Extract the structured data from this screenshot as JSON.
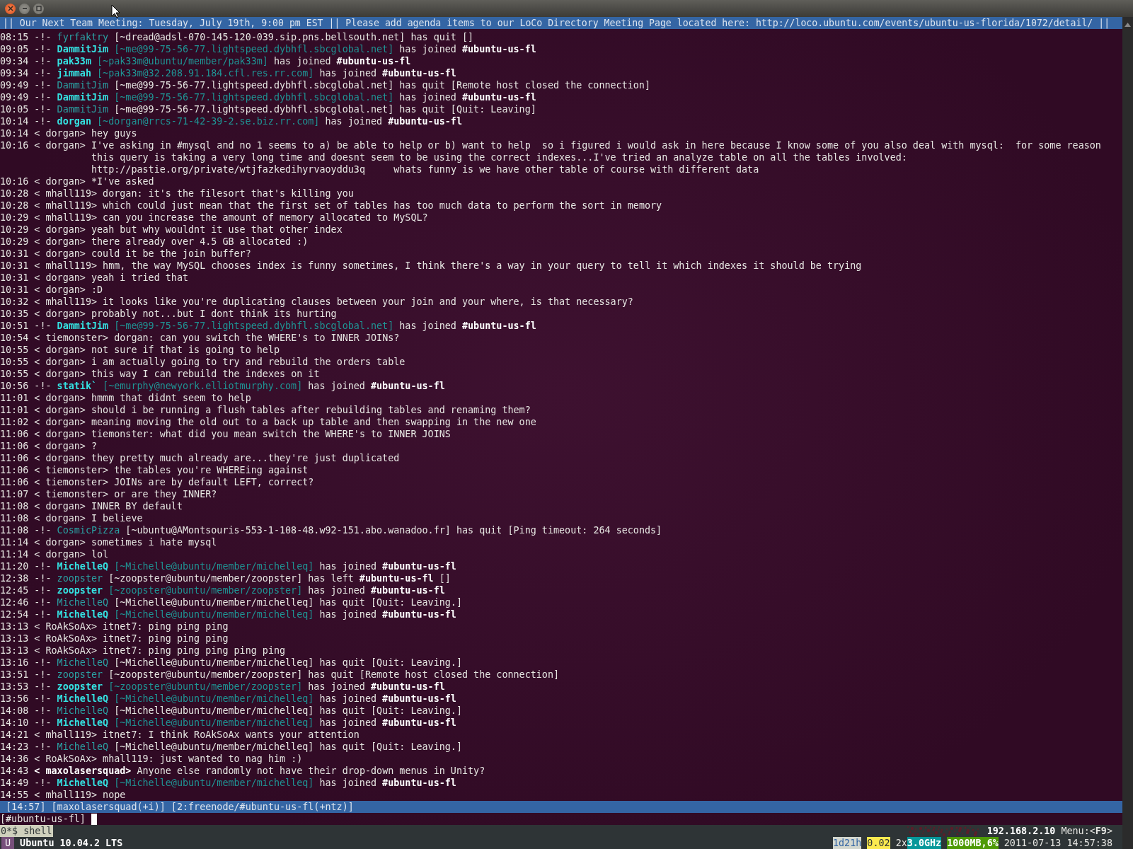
{
  "window": {
    "buttons": [
      {
        "kind": "close"
      },
      {
        "kind": "minimize"
      },
      {
        "kind": "maximize"
      }
    ]
  },
  "topic": "|| Our Next Team Meeting: Tuesday, July 19th, 9:00 pm EST || Please add agenda items to our LoCo Directory Meeting Page located here: http://loco.ubuntu.com/events/ubuntu-us-florida/1072/detail/ ||",
  "log": [
    {
      "kind": "quit",
      "time": "08:15",
      "marker": "-!-",
      "nick": "fyrfaktry",
      "host": "[~dread@adsl-070-145-120-039.sip.pns.bellsouth.net]",
      "action": "has quit",
      "reason": "[]"
    },
    {
      "kind": "join",
      "time": "09:05",
      "marker": "-!-",
      "nick": "DammitJim",
      "host": "[~me@99-75-56-77.lightspeed.dybhfl.sbcglobal.net]",
      "action": "has joined",
      "channel": "#ubuntu-us-fl"
    },
    {
      "kind": "join",
      "time": "09:34",
      "marker": "-!-",
      "nick": "pak33m",
      "host": "[~pak33m@ubuntu/member/pak33m]",
      "action": "has joined",
      "channel": "#ubuntu-us-fl"
    },
    {
      "kind": "join",
      "time": "09:34",
      "marker": "-!-",
      "nick": "jimmah",
      "host": "[~pak33m@32.208.91.184.cfl.res.rr.com]",
      "action": "has joined",
      "channel": "#ubuntu-us-fl"
    },
    {
      "kind": "quit",
      "time": "09:49",
      "marker": "-!-",
      "nick": "DammitJim",
      "host": "[~me@99-75-56-77.lightspeed.dybhfl.sbcglobal.net]",
      "action": "has quit",
      "reason": "[Remote host closed the connection]"
    },
    {
      "kind": "join",
      "time": "09:49",
      "marker": "-!-",
      "nick": "DammitJim",
      "host": "[~me@99-75-56-77.lightspeed.dybhfl.sbcglobal.net]",
      "action": "has joined",
      "channel": "#ubuntu-us-fl"
    },
    {
      "kind": "quit",
      "time": "10:05",
      "marker": "-!-",
      "nick": "DammitJim",
      "host": "[~me@99-75-56-77.lightspeed.dybhfl.sbcglobal.net]",
      "action": "has quit",
      "reason": "[Quit: Leaving]"
    },
    {
      "kind": "join",
      "time": "10:14",
      "marker": "-!-",
      "nick": "dorgan",
      "host": "[~dorgan@rrcs-71-42-39-2.se.biz.rr.com]",
      "action": "has joined",
      "channel": "#ubuntu-us-fl"
    },
    {
      "kind": "message",
      "time": "10:14",
      "nick": "< dorgan>",
      "text": "hey guys",
      "own": false
    },
    {
      "kind": "message",
      "time": "10:16",
      "nick": "< dorgan>",
      "text": "I've asking in #mysql and no 1 seems to a) be able to help or b) want to help  so i figured i would ask in here because I know some of you also deal with mysql:  for some reason",
      "more": [
        "this query is taking a very long time and doesnt seem to be using the correct indexes...I've tried an analyze table on all the tables involved:",
        "http://pastie.org/private/wtjfazkedihyrvaoyddu3q     whats funny is we have other table of course with different data"
      ],
      "own": false
    },
    {
      "kind": "message",
      "time": "10:16",
      "nick": "< dorgan>",
      "text": "*I've asked",
      "own": false
    },
    {
      "kind": "message",
      "time": "10:28",
      "nick": "< mhall119>",
      "text": "dorgan: it's the filesort that's killing you",
      "own": false
    },
    {
      "kind": "message",
      "time": "10:28",
      "nick": "< mhall119>",
      "text": "which could just mean that the first set of tables has too much data to perform the sort in memory",
      "own": false
    },
    {
      "kind": "message",
      "time": "10:29",
      "nick": "< mhall119>",
      "text": "can you increase the amount of memory allocated to MySQL?",
      "own": false
    },
    {
      "kind": "message",
      "time": "10:29",
      "nick": "< dorgan>",
      "text": "yeah but why wouldnt it use that other index",
      "own": false
    },
    {
      "kind": "message",
      "time": "10:29",
      "nick": "< dorgan>",
      "text": "there already over 4.5 GB allocated :)",
      "own": false
    },
    {
      "kind": "message",
      "time": "10:31",
      "nick": "< dorgan>",
      "text": "could it be the join buffer?",
      "own": false
    },
    {
      "kind": "message",
      "time": "10:31",
      "nick": "< mhall119>",
      "text": "hmm, the way MySQL chooses index is funny sometimes, I think there's a way in your query to tell it which indexes it should be trying",
      "own": false
    },
    {
      "kind": "message",
      "time": "10:31",
      "nick": "< dorgan>",
      "text": "yeah i tried that",
      "own": false
    },
    {
      "kind": "message",
      "time": "10:31",
      "nick": "< dorgan>",
      "text": ":D",
      "own": false
    },
    {
      "kind": "message",
      "time": "10:32",
      "nick": "< mhall119>",
      "text": "it looks like you're duplicating clauses between your join and your where, is that necessary?",
      "own": false
    },
    {
      "kind": "message",
      "time": "10:35",
      "nick": "< dorgan>",
      "text": "probably not...but I dont think its hurting",
      "own": false
    },
    {
      "kind": "join",
      "time": "10:51",
      "marker": "-!-",
      "nick": "DammitJim",
      "host": "[~me@99-75-56-77.lightspeed.dybhfl.sbcglobal.net]",
      "action": "has joined",
      "channel": "#ubuntu-us-fl"
    },
    {
      "kind": "message",
      "time": "10:54",
      "nick": "< tiemonster>",
      "text": "dorgan: can you switch the WHERE's to INNER JOINs?",
      "own": false
    },
    {
      "kind": "message",
      "time": "10:55",
      "nick": "< dorgan>",
      "text": "not sure if that is going to help",
      "own": false
    },
    {
      "kind": "message",
      "time": "10:55",
      "nick": "< dorgan>",
      "text": "i am actually going to try and rebuild the orders table",
      "own": false
    },
    {
      "kind": "message",
      "time": "10:55",
      "nick": "< dorgan>",
      "text": "this way I can rebuild the indexes on it",
      "own": false
    },
    {
      "kind": "join",
      "time": "10:56",
      "marker": "-!-",
      "nick": "statik`",
      "host": "[~emurphy@newyork.elliotmurphy.com]",
      "action": "has joined",
      "channel": "#ubuntu-us-fl"
    },
    {
      "kind": "message",
      "time": "11:01",
      "nick": "< dorgan>",
      "text": "hmmm that didnt seem to help",
      "own": false
    },
    {
      "kind": "message",
      "time": "11:01",
      "nick": "< dorgan>",
      "text": "should i be running a flush tables after rebuilding tables and renaming them?",
      "own": false
    },
    {
      "kind": "message",
      "time": "11:02",
      "nick": "< dorgan>",
      "text": "meaning moving the old out to a back up table and then swapping in the new one",
      "own": false
    },
    {
      "kind": "message",
      "time": "11:06",
      "nick": "< dorgan>",
      "text": "tiemonster: what did you mean switch the WHERE's to INNER JOINS",
      "own": false
    },
    {
      "kind": "message",
      "time": "11:06",
      "nick": "< dorgan>",
      "text": "?",
      "own": false
    },
    {
      "kind": "message",
      "time": "11:06",
      "nick": "< dorgan>",
      "text": "they pretty much already are...they're just duplicated",
      "own": false
    },
    {
      "kind": "message",
      "time": "11:06",
      "nick": "< tiemonster>",
      "text": "the tables you're WHEREing against",
      "own": false
    },
    {
      "kind": "message",
      "time": "11:06",
      "nick": "< tiemonster>",
      "text": "JOINs are by default LEFT, correct?",
      "own": false
    },
    {
      "kind": "message",
      "time": "11:07",
      "nick": "< tiemonster>",
      "text": "or are they INNER?",
      "own": false
    },
    {
      "kind": "message",
      "time": "11:08",
      "nick": "< dorgan>",
      "text": "INNER BY default",
      "own": false
    },
    {
      "kind": "message",
      "time": "11:08",
      "nick": "< dorgan>",
      "text": "I believe",
      "own": false
    },
    {
      "kind": "quit",
      "time": "11:08",
      "marker": "-!-",
      "nick": "CosmicPizza",
      "host": "[~ubuntu@AMontsouris-553-1-108-48.w92-151.abo.wanadoo.fr]",
      "action": "has quit",
      "reason": "[Ping timeout: 264 seconds]"
    },
    {
      "kind": "message",
      "time": "11:14",
      "nick": "< dorgan>",
      "text": "sometimes i hate mysql",
      "own": false
    },
    {
      "kind": "message",
      "time": "11:14",
      "nick": "< dorgan>",
      "text": "lol",
      "own": false
    },
    {
      "kind": "join",
      "time": "11:20",
      "marker": "-!-",
      "nick": "MichelleQ",
      "host": "[~Michelle@ubuntu/member/michelleq]",
      "action": "has joined",
      "channel": "#ubuntu-us-fl"
    },
    {
      "kind": "part",
      "time": "12:38",
      "marker": "-!-",
      "nick": "zoopster",
      "host": "[~zoopster@ubuntu/member/zoopster]",
      "action": "has left",
      "channel": "#ubuntu-us-fl",
      "reason": "[]"
    },
    {
      "kind": "join",
      "time": "12:45",
      "marker": "-!-",
      "nick": "zoopster",
      "host": "[~zoopster@ubuntu/member/zoopster]",
      "action": "has joined",
      "channel": "#ubuntu-us-fl"
    },
    {
      "kind": "quit",
      "time": "12:46",
      "marker": "-!-",
      "nick": "MichelleQ",
      "host": "[~Michelle@ubuntu/member/michelleq]",
      "action": "has quit",
      "reason": "[Quit: Leaving.]"
    },
    {
      "kind": "join",
      "time": "12:54",
      "marker": "-!-",
      "nick": "MichelleQ",
      "host": "[~Michelle@ubuntu/member/michelleq]",
      "action": "has joined",
      "channel": "#ubuntu-us-fl"
    },
    {
      "kind": "message",
      "time": "13:13",
      "nick": "< RoAkSoAx>",
      "text": "itnet7: ping ping ping",
      "own": false
    },
    {
      "kind": "message",
      "time": "13:13",
      "nick": "< RoAkSoAx>",
      "text": "itnet7: ping ping ping",
      "own": false
    },
    {
      "kind": "message",
      "time": "13:13",
      "nick": "< RoAkSoAx>",
      "text": "itnet7: ping ping ping ping ping",
      "own": false
    },
    {
      "kind": "quit",
      "time": "13:16",
      "marker": "-!-",
      "nick": "MichelleQ",
      "host": "[~Michelle@ubuntu/member/michelleq]",
      "action": "has quit",
      "reason": "[Quit: Leaving.]"
    },
    {
      "kind": "quit",
      "time": "13:51",
      "marker": "-!-",
      "nick": "zoopster",
      "host": "[~zoopster@ubuntu/member/zoopster]",
      "action": "has quit",
      "reason": "[Remote host closed the connection]"
    },
    {
      "kind": "join",
      "time": "13:53",
      "marker": "-!-",
      "nick": "zoopster",
      "host": "[~zoopster@ubuntu/member/zoopster]",
      "action": "has joined",
      "channel": "#ubuntu-us-fl"
    },
    {
      "kind": "join",
      "time": "13:56",
      "marker": "-!-",
      "nick": "MichelleQ",
      "host": "[~Michelle@ubuntu/member/michelleq]",
      "action": "has joined",
      "channel": "#ubuntu-us-fl"
    },
    {
      "kind": "quit",
      "time": "14:08",
      "marker": "-!-",
      "nick": "MichelleQ",
      "host": "[~Michelle@ubuntu/member/michelleq]",
      "action": "has quit",
      "reason": "[Quit: Leaving.]"
    },
    {
      "kind": "join",
      "time": "14:10",
      "marker": "-!-",
      "nick": "MichelleQ",
      "host": "[~Michelle@ubuntu/member/michelleq]",
      "action": "has joined",
      "channel": "#ubuntu-us-fl"
    },
    {
      "kind": "message",
      "time": "14:21",
      "nick": "< mhall119>",
      "text": "itnet7: I think RoAkSoAx wants your attention",
      "own": false
    },
    {
      "kind": "quit",
      "time": "14:23",
      "marker": "-!-",
      "nick": "MichelleQ",
      "host": "[~Michelle@ubuntu/member/michelleq]",
      "action": "has quit",
      "reason": "[Quit: Leaving.]"
    },
    {
      "kind": "message",
      "time": "14:36",
      "nick": "< RoAkSoAx>",
      "text": "mhall119: just wanted to nag him :)",
      "own": false
    },
    {
      "kind": "message",
      "time": "14:43",
      "nick": "< maxolasersquad>",
      "text": "Anyone else randomly not have their drop-down menus in Unity?",
      "own": true
    },
    {
      "kind": "join",
      "time": "14:49",
      "marker": "-!-",
      "nick": "MichelleQ",
      "host": "[~Michelle@ubuntu/member/michelleq]",
      "action": "has joined",
      "channel": "#ubuntu-us-fl"
    },
    {
      "kind": "message",
      "time": "14:55",
      "nick": "< mhall119>",
      "text": "nope",
      "own": false
    }
  ],
  "status_bar": [
    "[14:57]",
    "[maxolasersquad(+i)]",
    "[2:freenode/#ubuntu-us-fl(+ntz)]"
  ],
  "input": {
    "prompt": "[#ubuntu-us-fl]"
  },
  "byobu": {
    "windows": [
      {
        "label": "0*$ shell",
        "selected": true
      }
    ],
    "ip": "192.168.2.10",
    "menu": "Menu:<**F9**>",
    "logo": "U",
    "os": "Ubuntu 10.04.2 LTS",
    "stats": [
      {
        "kind": "uptime",
        "text": "1d21h"
      },
      {
        "kind": "load",
        "text": "0.02"
      },
      {
        "kind": "cpu_count",
        "text": "2x"
      },
      {
        "kind": "cpu_freq",
        "text": "3.0GHz"
      },
      {
        "kind": "memory",
        "text": "1000MB,6%"
      },
      {
        "kind": "clock",
        "text": "2011-07-13 14:57:38"
      }
    ]
  }
}
